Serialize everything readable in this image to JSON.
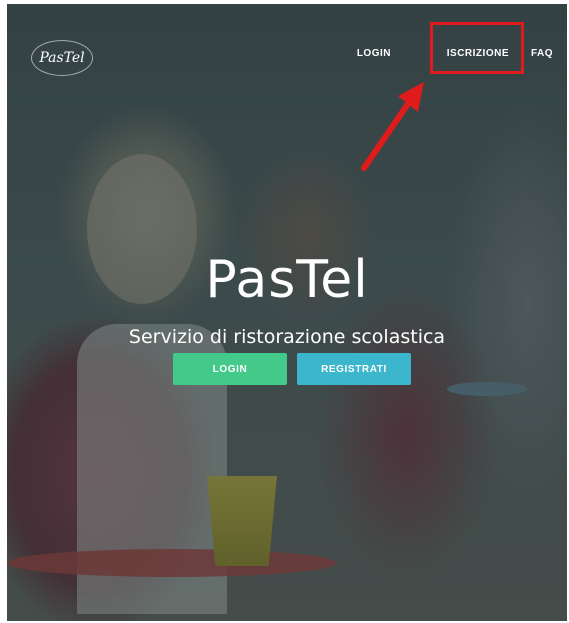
{
  "brand": {
    "logo_text": "PasTel"
  },
  "nav": {
    "login": "LOGIN",
    "iscrizione": "ISCRIZIONE",
    "faq": "FAQ"
  },
  "hero": {
    "title": "PasTel",
    "subtitle": "Servizio di ristorazione scolastica",
    "login_button": "LOGIN",
    "register_button": "REGISTRATI"
  },
  "colors": {
    "login_button": "#43c98a",
    "register_button": "#3cb6cc",
    "annotation": "#e01b1b"
  },
  "annotation": {
    "target": "ISCRIZIONE"
  }
}
